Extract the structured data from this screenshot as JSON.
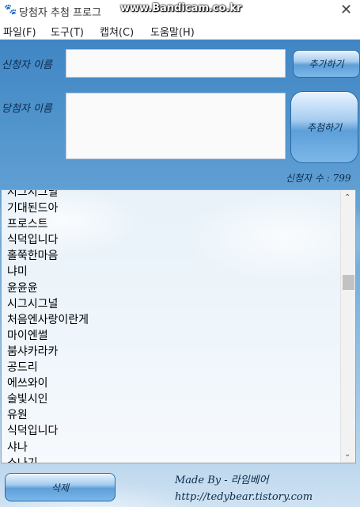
{
  "window": {
    "title": "당첨자 추첨 프로그",
    "watermark": "www.Bandicam.co.kr",
    "icons": {
      "app": "bear-icon",
      "close": "close-icon"
    }
  },
  "menu": {
    "items": [
      {
        "label": "파일(F)"
      },
      {
        "label": "도구(T)"
      },
      {
        "label": "캡쳐(C)"
      },
      {
        "label": "도움말(H)"
      }
    ]
  },
  "form": {
    "applicant_label": "신청자 이름",
    "applicant_value": "",
    "add_button": "추가하기",
    "winner_label": "당첨자 이름",
    "winner_value": "",
    "draw_button": "추첨하기",
    "count_label": "신청자 수 : 799"
  },
  "list": {
    "items": [
      "시그시그널",
      "기대된드아",
      "프로스트",
      " 식덕입니다",
      "홀쭉한마음",
      "냐미",
      "윤윤윤",
      "시그시그널",
      "처음엔사랑이란게",
      "마이엔썰",
      "붐샤카라카",
      "공드리",
      "에쓰와이",
      "술빛시인",
      "유원",
      "식덕입니다",
      "샤나",
      "소나기"
    ],
    "scroll_up": "⌃",
    "scroll_down": "⌄"
  },
  "footer": {
    "delete_button": "삭제",
    "made_by": "Made By - 라임베어",
    "url": "http://tedybear.tistory.com"
  },
  "colors": {
    "background_top": "#3f86c4",
    "background_bottom": "#cfe2f2",
    "button_border": "#2a6aa4"
  }
}
